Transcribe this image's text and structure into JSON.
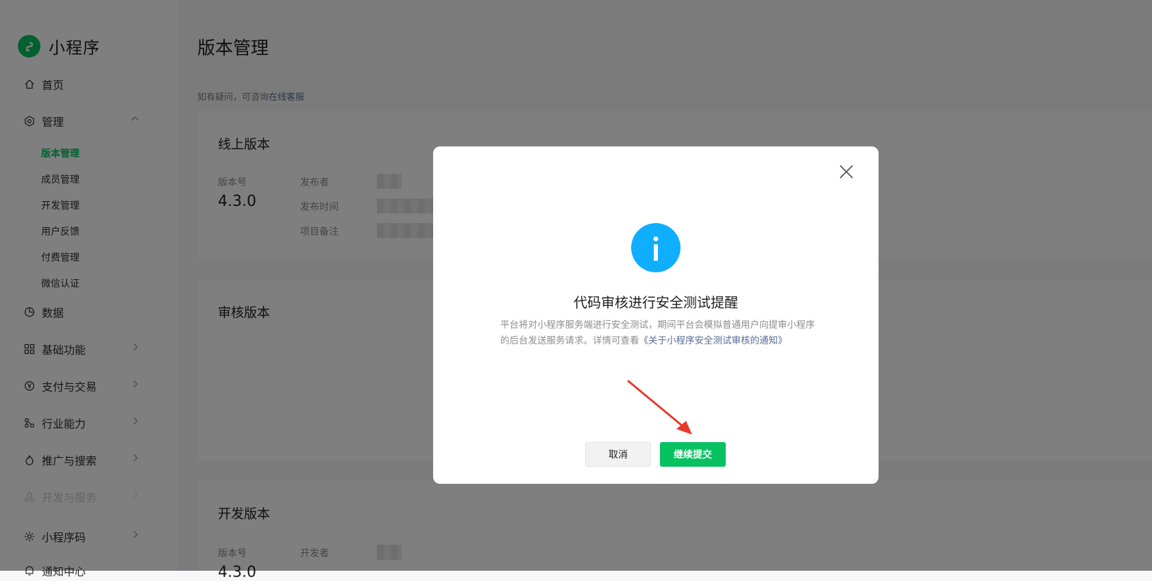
{
  "brand": {
    "name": "小程序",
    "logo_icon": "mini-program-logo-icon"
  },
  "sidebar": {
    "home": "首页",
    "manage": "管理",
    "manage_items": [
      "版本管理",
      "成员管理",
      "开发管理",
      "用户反馈",
      "付费管理",
      "微信认证"
    ],
    "data": "数据",
    "basic": "基础功能",
    "pay": "支付与交易",
    "industry": "行业能力",
    "promote": "推广与搜索",
    "dev_service": "开发与服务",
    "qrcode": "小程序码",
    "notify": "通知中心"
  },
  "page": {
    "title": "版本管理",
    "hint_prefix": "如有疑问，可咨询",
    "hint_link": "在线客服"
  },
  "online": {
    "title": "线上版本",
    "version_label": "版本号",
    "version": "4.3.0",
    "publisher_label": "发布者",
    "time_label": "发布时间",
    "remark_label": "项目备注"
  },
  "review": {
    "title": "审核版本"
  },
  "dev": {
    "title": "开发版本",
    "version_label": "版本号",
    "developer_label": "开发者",
    "version": "4.3.0"
  },
  "dialog": {
    "title": "代码审核进行安全测试提醒",
    "text": "平台将对小程序服务端进行安全测试，期间平台会模拟普通用户向提审小程序的后台发送服务请求。详情可查看",
    "link": "《关于小程序安全测试审核的通知》",
    "cancel": "取消",
    "submit": "继续提交"
  },
  "colors": {
    "brand": "#07c160",
    "info": "#10aeff",
    "link": "#576b95",
    "annotation": "#e8392c"
  }
}
